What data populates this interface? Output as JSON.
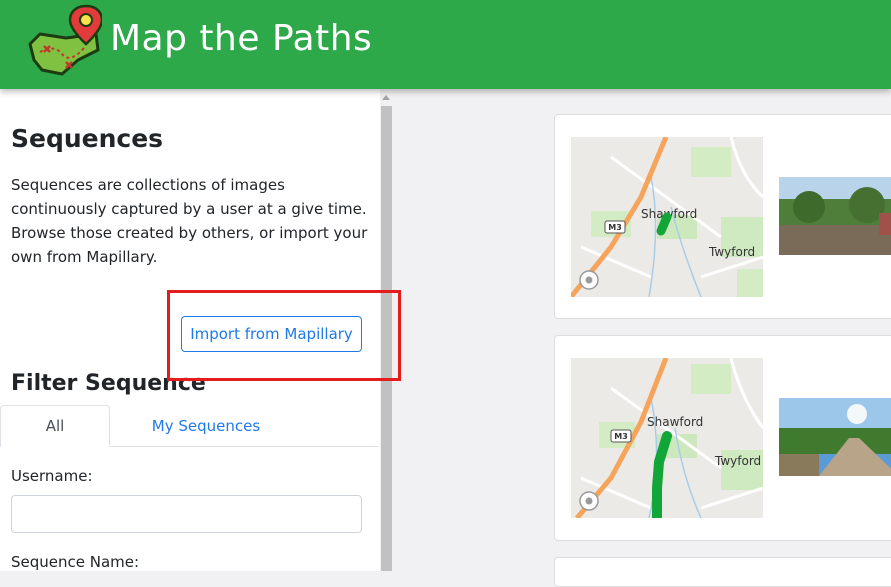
{
  "header": {
    "app_title": "Map the Paths",
    "logo_icon": "map-pin-logo-icon",
    "background_color": "#2ea94a"
  },
  "sidebar": {
    "section_title": "Sequences",
    "section_description": "Sequences are collections of images continuously captured by a user at a give time. Browse those created by others, or import your own from Mapillary.",
    "import_button_label": "Import from Mapillary",
    "filter_title": "Filter Sequence",
    "tabs": [
      {
        "label": "All",
        "active": true
      },
      {
        "label": "My Sequences",
        "active": false
      }
    ],
    "username_label": "Username:",
    "username_value": "",
    "sequence_name_label": "Sequence Name:"
  },
  "sequences": [
    {
      "map_labels": {
        "town1": "Shawford",
        "town2": "Twyford",
        "road": "M3"
      }
    },
    {
      "map_labels": {
        "town1": "Shawford",
        "town2": "Twyford",
        "road": "M3"
      }
    }
  ],
  "colors": {
    "accent": "#1f7ae8",
    "highlight": "#e31c1c",
    "route": "#12a538",
    "motorway": "#f6a35c"
  }
}
